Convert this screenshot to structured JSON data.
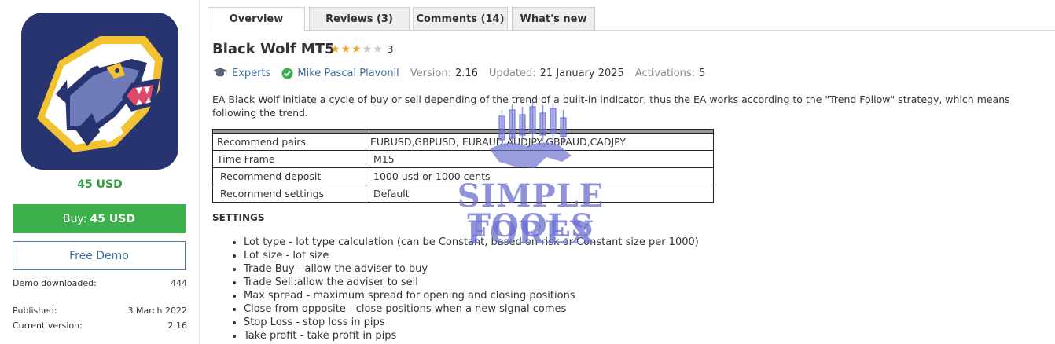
{
  "sidebar": {
    "price": "45 USD",
    "buy_label": "Buy:",
    "buy_price": "45 USD",
    "demo_label": "Free Demo",
    "stats": [
      {
        "label": "Demo downloaded:",
        "value": "444"
      },
      {
        "label": "Published:",
        "value": "3 March 2022"
      },
      {
        "label": "Current version:",
        "value": "2.16"
      }
    ]
  },
  "tabs": [
    {
      "label": "Overview"
    },
    {
      "label": "Reviews (3)"
    },
    {
      "label": "Comments (14)"
    },
    {
      "label": "What's new"
    }
  ],
  "product": {
    "title": "Black Wolf MT5",
    "rating": 3,
    "rating_count": "3",
    "category": "Experts",
    "author": "Mike Pascal Plavonil",
    "version_label": "Version:",
    "version": "2.16",
    "updated_label": "Updated:",
    "updated": "21 January 2025",
    "activations_label": "Activations:",
    "activations": "5",
    "description": "EA Black Wolf initiate a cycle of buy or sell depending of the trend of a built-in indicator, thus the EA works according to the \"Trend Follow\" strategy, which means following the trend."
  },
  "spec_table": [
    {
      "key": "Recommend pairs",
      "value": "EURUSD,GBPUSD, EURAUD,AUDJPY,GBPAUD,CADJPY"
    },
    {
      "key": "Time Frame",
      "value": "M15"
    },
    {
      "key": "Recommend deposit",
      "value": "1000 usd or 1000 cents"
    },
    {
      "key": "Recommend settings",
      "value": "Default"
    }
  ],
  "settings": {
    "heading": "SETTINGS",
    "items": [
      "Lot type - lot type calculation (can be Constant, based on risk or Constant size per 1000)",
      "Lot size - lot size",
      "Trade Buy - allow the adviser to buy",
      "Trade Sell:allow the adviser to sell",
      "Max spread - maximum spread for opening and closing positions",
      "Close from opposite - close positions when a new signal comes",
      "Stop Loss - stop loss in pips",
      "Take profit - take profit in pips"
    ]
  },
  "watermark": {
    "line1": "SIMPLE FOREX",
    "line2": "TOOLS"
  },
  "colors": {
    "accent_green": "#3cb04a",
    "link_blue": "#3a6ea5",
    "star": "#f0a31e",
    "logo_bg": "#27346f"
  }
}
